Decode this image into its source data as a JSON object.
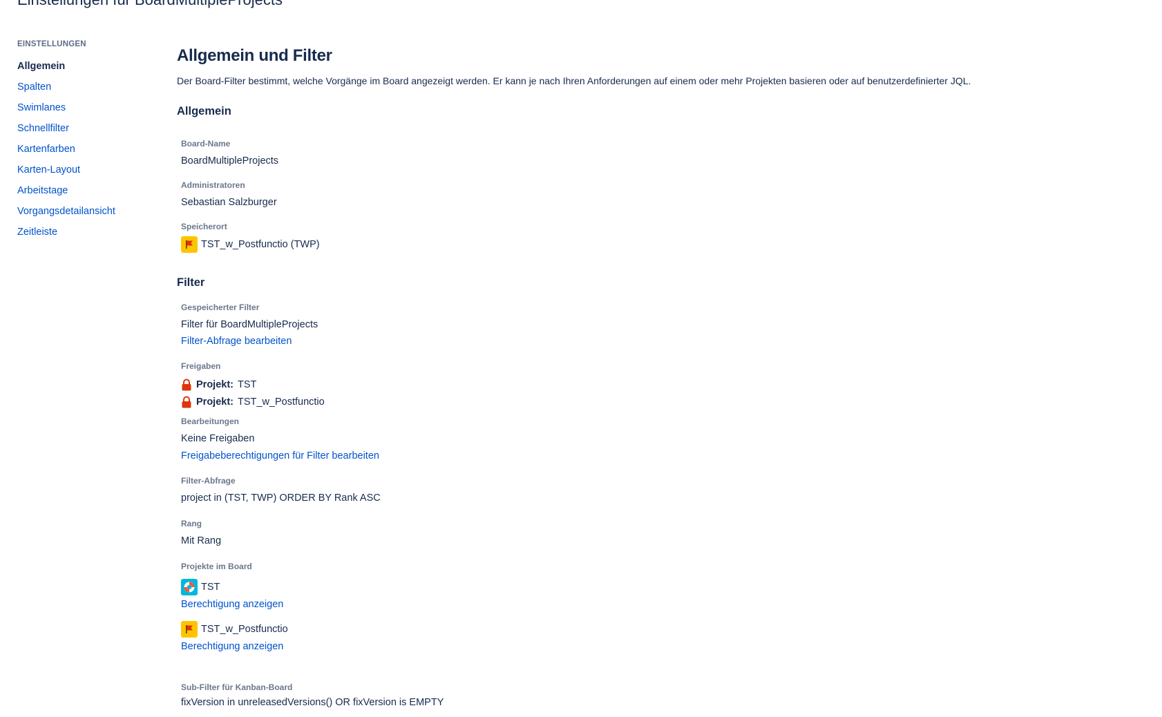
{
  "header": {
    "title": "Einstellungen für BoardMultipleProjects"
  },
  "sidebar": {
    "heading": "EINSTELLUNGEN",
    "items": [
      {
        "label": "Allgemein",
        "active": true
      },
      {
        "label": "Spalten"
      },
      {
        "label": "Swimlanes"
      },
      {
        "label": "Schnellfilter"
      },
      {
        "label": "Kartenfarben"
      },
      {
        "label": "Karten-Layout"
      },
      {
        "label": "Arbeitstage"
      },
      {
        "label": "Vorgangsdetailansicht"
      },
      {
        "label": "Zeitleiste"
      }
    ]
  },
  "main": {
    "title": "Allgemein und Filter",
    "description": "Der Board-Filter bestimmt, welche Vorgänge im Board angezeigt werden. Er kann je nach Ihren Anforderungen auf einem oder mehr Projekten basieren oder auf benutzerdefinierter JQL.",
    "general": {
      "heading": "Allgemein",
      "board_name_label": "Board-Name",
      "board_name": "BoardMultipleProjects",
      "admins_label": "Administratoren",
      "admins": "Sebastian Salzburger",
      "location_label": "Speicherort",
      "location": "TST_w_Postfunctio (TWP)",
      "location_icon": "red-flag-icon"
    },
    "filter": {
      "heading": "Filter",
      "saved_filter_label": "Gespeicherter Filter",
      "saved_filter": "Filter für BoardMultipleProjects",
      "edit_query_link": "Filter-Abfrage bearbeiten",
      "shares_label": "Freigaben",
      "shares": [
        {
          "prefix": "Projekt:",
          "value": "TST"
        },
        {
          "prefix": "Projekt:",
          "value": "TST_w_Postfunctio"
        }
      ],
      "edits_label": "Bearbeitungen",
      "edits_value": "Keine Freigaben",
      "edit_permissions_link": "Freigabeberechtigungen für Filter bearbeiten",
      "query_label": "Filter-Abfrage",
      "query": "project in (TST, TWP) ORDER BY Rank ASC",
      "rank_label": "Rang",
      "rank": "Mit Rang",
      "projects_label": "Projekte im Board",
      "projects": [
        {
          "name": "TST",
          "icon": "lifebuoy-icon",
          "link": "Berechtigung anzeigen"
        },
        {
          "name": "TST_w_Postfunctio",
          "icon": "red-flag-icon",
          "link": "Berechtigung anzeigen"
        }
      ],
      "subfilter_label": "Sub-Filter für Kanban-Board",
      "subfilter": "fixVersion in unreleasedVersions() OR fixVersion is EMPTY"
    }
  },
  "colors": {
    "link": "#0052cc",
    "text": "#172b4d",
    "label": "#6b778c",
    "lock": "#de350b"
  }
}
